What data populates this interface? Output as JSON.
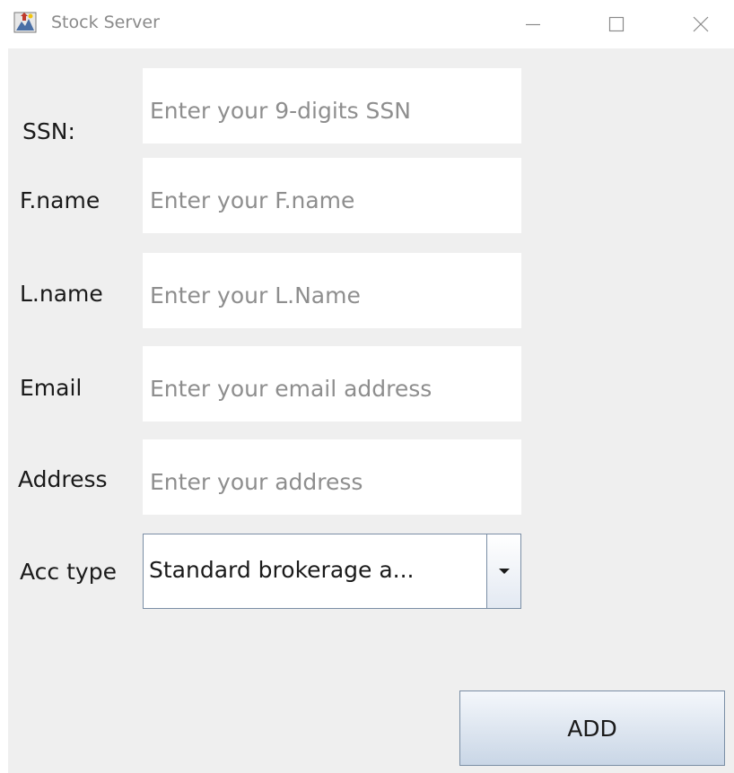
{
  "window": {
    "title": "Stock Server",
    "app_icon": "java-app-icon",
    "controls": [
      "minimize-icon",
      "maximize-icon",
      "close-icon"
    ]
  },
  "form": {
    "ssn": {
      "label": "SSN:",
      "value": "",
      "placeholder": "Enter your 9-digits SSN"
    },
    "first_name": {
      "label": "F.name",
      "value": "",
      "placeholder": "Enter your F.name"
    },
    "last_name": {
      "label": "L.name",
      "value": "",
      "placeholder": "Enter your L.Name"
    },
    "email": {
      "label": "Email",
      "value": "",
      "placeholder": "Enter your email address"
    },
    "address": {
      "label": "Address",
      "value": "",
      "placeholder": "Enter your address"
    },
    "acc_type": {
      "label": "Acc type",
      "selected": "Standard brokerage a...",
      "icon": "chevron-down-icon"
    }
  },
  "actions": {
    "add_label": "ADD"
  },
  "colors": {
    "titlebar_bg": "#ffffff",
    "content_bg": "#efefef",
    "field_bg": "#ffffff",
    "placeholder_text": "#8e8e8e",
    "label_text": "#1a1a1a",
    "button_border": "#7a8ea5"
  }
}
